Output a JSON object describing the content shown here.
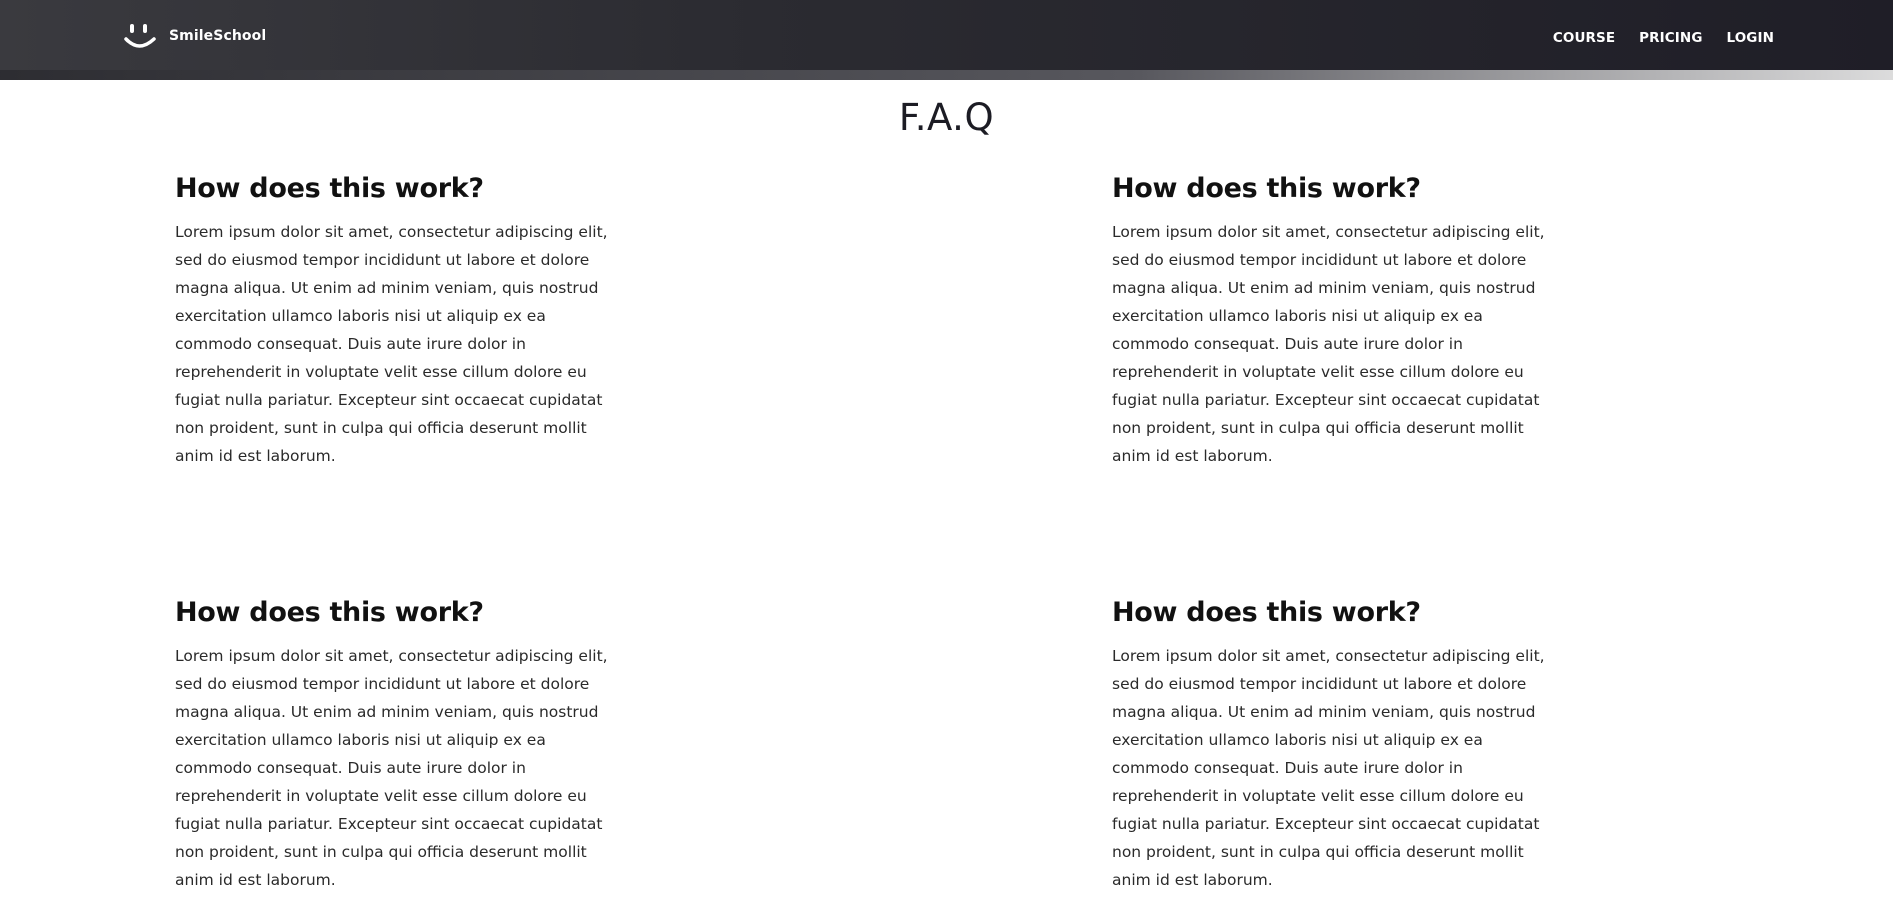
{
  "header": {
    "brand": "SmileSchool",
    "logo_icon": "smiley-logo-icon",
    "nav": [
      "COURSE",
      "PRICING",
      "LOGIN"
    ]
  },
  "faq": {
    "title": "F.A.Q",
    "items": [
      {
        "question": "How does this work?",
        "answer": "Lorem ipsum dolor sit amet, consectetur adipiscing elit, sed do eiusmod tempor incididunt ut labore et dolore magna aliqua. Ut enim ad minim veniam, quis nostrud exercitation ullamco laboris nisi ut aliquip ex ea commodo consequat. Duis aute irure dolor in reprehenderit in voluptate velit esse cillum dolore eu fugiat nulla pariatur. Excepteur sint occaecat cupidatat non proident, sunt in culpa qui officia deserunt mollit anim id est laborum."
      },
      {
        "question": "How does this work?",
        "answer": "Lorem ipsum dolor sit amet, consectetur adipiscing elit, sed do eiusmod tempor incididunt ut labore et dolore magna aliqua. Ut enim ad minim veniam, quis nostrud exercitation ullamco laboris nisi ut aliquip ex ea commodo consequat. Duis aute irure dolor in reprehenderit in voluptate velit esse cillum dolore eu fugiat nulla pariatur. Excepteur sint occaecat cupidatat non proident, sunt in culpa qui officia deserunt mollit anim id est laborum."
      },
      {
        "question": "How does this work?",
        "answer": "Lorem ipsum dolor sit amet, consectetur adipiscing elit, sed do eiusmod tempor incididunt ut labore et dolore magna aliqua. Ut enim ad minim veniam, quis nostrud exercitation ullamco laboris nisi ut aliquip ex ea commodo consequat. Duis aute irure dolor in reprehenderit in voluptate velit esse cillum dolore eu fugiat nulla pariatur. Excepteur sint occaecat cupidatat non proident, sunt in culpa qui officia deserunt mollit anim id est laborum."
      },
      {
        "question": "How does this work?",
        "answer": "Lorem ipsum dolor sit amet, consectetur adipiscing elit, sed do eiusmod tempor incididunt ut labore et dolore magna aliqua. Ut enim ad minim veniam, quis nostrud exercitation ullamco laboris nisi ut aliquip ex ea commodo consequat. Duis aute irure dolor in reprehenderit in voluptate velit esse cillum dolore eu fugiat nulla pariatur. Excepteur sint occaecat cupidatat non proident, sunt in culpa qui officia deserunt mollit anim id est laborum."
      }
    ]
  },
  "colors": {
    "header_bg_start": "#3a3a3f",
    "header_bg_end": "#1f1e27",
    "header_text": "#ffffff",
    "body_text": "#2a2a2a"
  }
}
